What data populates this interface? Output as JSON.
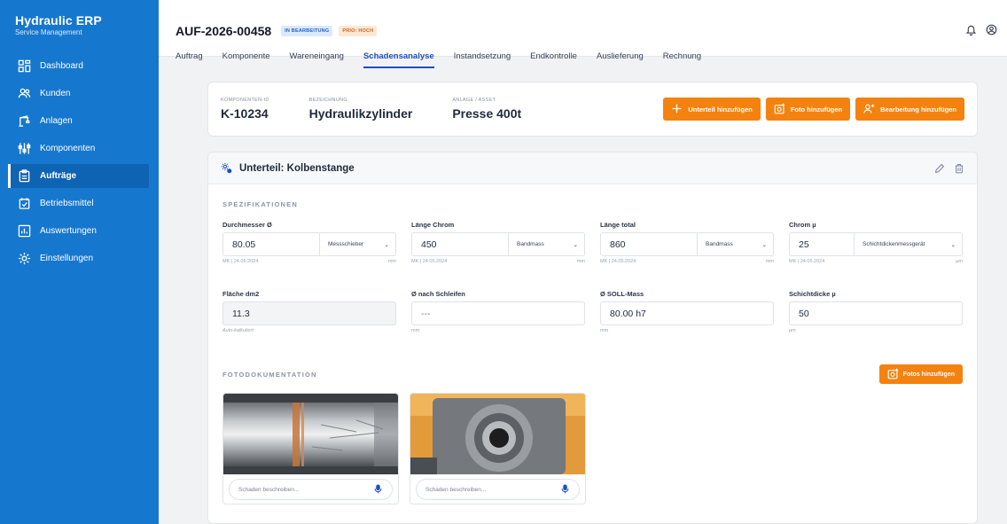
{
  "brand": {
    "title": "Hydraulic ERP",
    "subtitle": "Service Management"
  },
  "sidebar": {
    "items": [
      {
        "label": "Dashboard",
        "icon": "dashboard-icon"
      },
      {
        "label": "Kunden",
        "icon": "users-icon"
      },
      {
        "label": "Anlagen",
        "icon": "crane-icon"
      },
      {
        "label": "Komponenten",
        "icon": "components-icon"
      },
      {
        "label": "Aufträge",
        "icon": "clipboard-icon",
        "active": true
      },
      {
        "label": "Betriebsmittel",
        "icon": "tools-icon"
      },
      {
        "label": "Auswertungen",
        "icon": "chart-icon"
      },
      {
        "label": "Einstellungen",
        "icon": "gear-icon"
      }
    ]
  },
  "header": {
    "order_id": "AUF-2026-00458",
    "status_badge": "IN BEARBEITUNG",
    "prio_badge": "PRIO: HOCH",
    "tabs": [
      "Auftrag",
      "Komponente",
      "Wareneingang",
      "Schadensanalyse",
      "Instandsetzung",
      "Endkontrolle",
      "Auslieferung",
      "Rechnung"
    ],
    "active_tab": "Schadensanalyse"
  },
  "component": {
    "id_label": "KOMPONENTEN-ID",
    "id_value": "K-10234",
    "name_label": "BEZEICHNUNG",
    "name_value": "Hydraulikzylinder",
    "asset_label": "ANLAGE / ASSET",
    "asset_value": "Presse 400t",
    "buttons": {
      "add_part": "Unterteil hinzufügen",
      "add_photo": "Foto hinzufügen",
      "add_processing": "Bearbeitung hinzufügen"
    }
  },
  "part": {
    "title": "Unterteil: Kolbenstange",
    "spec_title": "SPEZIFIKATIONEN",
    "specs_row1": [
      {
        "label": "Durchmesser Ø",
        "value": "80.05",
        "tool": "Messschieber",
        "meta": "MK | 24.05.2024",
        "unit": "mm"
      },
      {
        "label": "Länge Chrom",
        "value": "450",
        "tool": "Bandmass",
        "meta": "MK | 24.05.2024",
        "unit": "mm"
      },
      {
        "label": "Länge total",
        "value": "860",
        "tool": "Bandmass",
        "meta": "MK | 24.05.2024",
        "unit": "mm"
      },
      {
        "label": "Chrom µ",
        "value": "25",
        "tool": "Schichtdickenmessgerät",
        "meta": "MK | 24.05.2024",
        "unit": "µm"
      }
    ],
    "specs_row2": [
      {
        "label": "Fläche dm2",
        "value": "11.3",
        "meta": "Auto-kalkuliert",
        "unit": ""
      },
      {
        "label": "Ø nach Schleifen",
        "value": "---",
        "meta": "mm",
        "unit": ""
      },
      {
        "label": "Ø SOLL-Mass",
        "value": "80.00 h7",
        "meta": "mm",
        "unit": ""
      },
      {
        "label": "Schichtdicke µ",
        "value": "50",
        "meta": "µm",
        "unit": ""
      }
    ],
    "foto_title": "FOTODOKUMENTATION",
    "add_photos_button": "Fotos hinzufügen",
    "photo_placeholder": "Schaden beschreiben..."
  },
  "colors": {
    "sidebar": "#1677ce",
    "accent": "#f4820f",
    "tab_active": "#1d4ec4"
  }
}
